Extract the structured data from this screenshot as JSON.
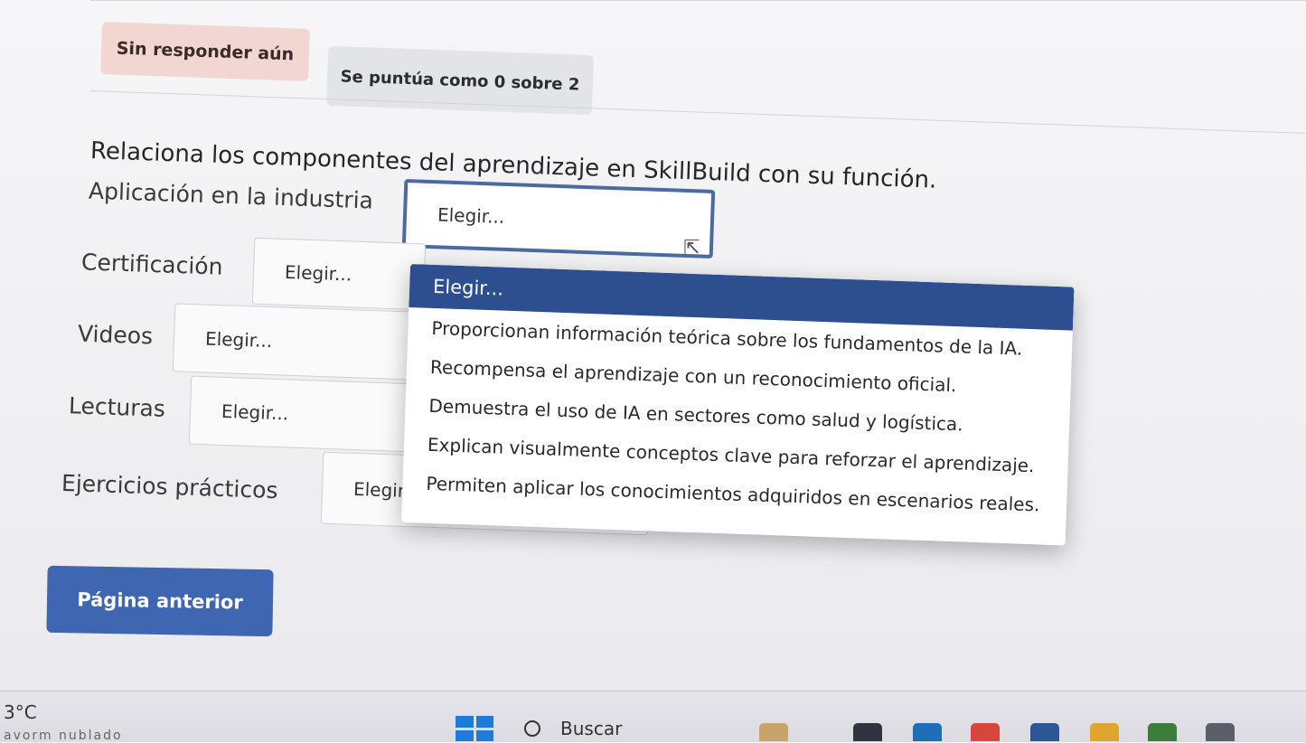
{
  "header": {
    "status": "Sin responder aún",
    "grade": "Se puntúa como 0 sobre 2"
  },
  "question": "Relaciona los componentes del aprendizaje en SkillBuild con su función.",
  "rows": [
    {
      "label": "Aplicación en la industria",
      "value": "Elegir..."
    },
    {
      "label": "Certificación",
      "value": "Elegir..."
    },
    {
      "label": "Videos",
      "value": "Elegir..."
    },
    {
      "label": "Lecturas",
      "value": "Elegir..."
    },
    {
      "label": "Ejercicios prácticos",
      "value": "Elegir..."
    }
  ],
  "dropdown": {
    "selected": "Elegir...",
    "options": [
      "Proporcionan información teórica sobre los fundamentos de la IA.",
      "Recompensa el aprendizaje con un reconocimiento oficial.",
      "Demuestra el uso de IA en sectores como salud y logística.",
      "Explican visualmente conceptos clave para reforzar el aprendizaje.",
      "Permiten aplicar los conocimientos adquiridos en escenarios reales."
    ]
  },
  "buttons": {
    "previous": "Página anterior"
  },
  "taskbar": {
    "temperature": "3°C",
    "weather": "avorm nublado",
    "search": "Buscar"
  },
  "icons": [
    "cursor-icon",
    "windows-start-icon",
    "search-icon",
    "caret-down-icon"
  ],
  "colors": {
    "primary": "#3f66b0",
    "dropdown_highlight": "#2d4e8f",
    "status_badge": "#f1d6d2"
  }
}
